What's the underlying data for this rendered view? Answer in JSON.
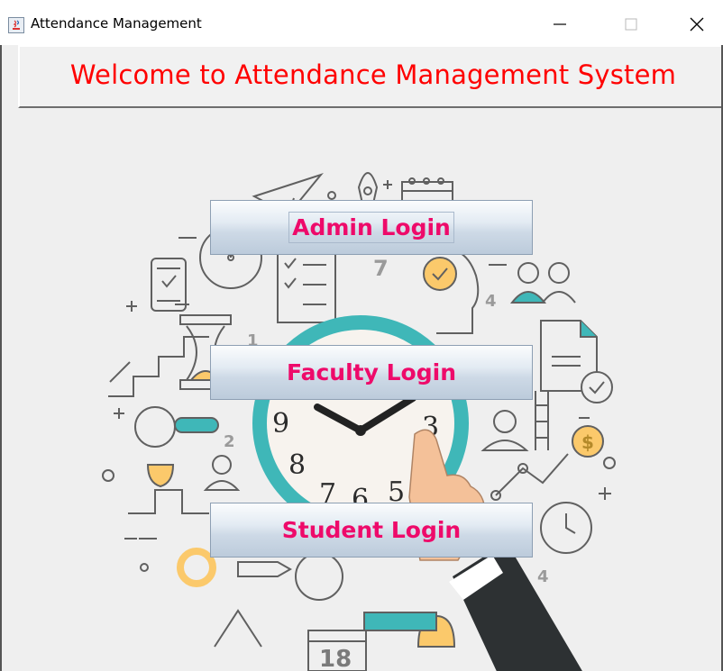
{
  "window": {
    "title": "Attendance Management",
    "controls": {
      "minimize": "minimize",
      "maximize": "maximize",
      "close": "close"
    }
  },
  "header": {
    "welcome_text": "Welcome to Attendance Management System",
    "text_color": "#ff0000"
  },
  "buttons": {
    "admin_label": "Admin Login",
    "faculty_label": "Faculty Login",
    "student_label": "Student Login",
    "label_color": "#ee0a6a"
  },
  "illustration": {
    "clock_numbers": [
      "9",
      "3",
      "8",
      "7",
      "6",
      "5"
    ],
    "calendar_number": "18",
    "decor_numbers": [
      "7",
      "4",
      "1",
      "2",
      "4"
    ],
    "coin_symbol": "$",
    "accent_colors": [
      "#3fb7b8",
      "#fbc96b",
      "#5a5a5a"
    ]
  }
}
